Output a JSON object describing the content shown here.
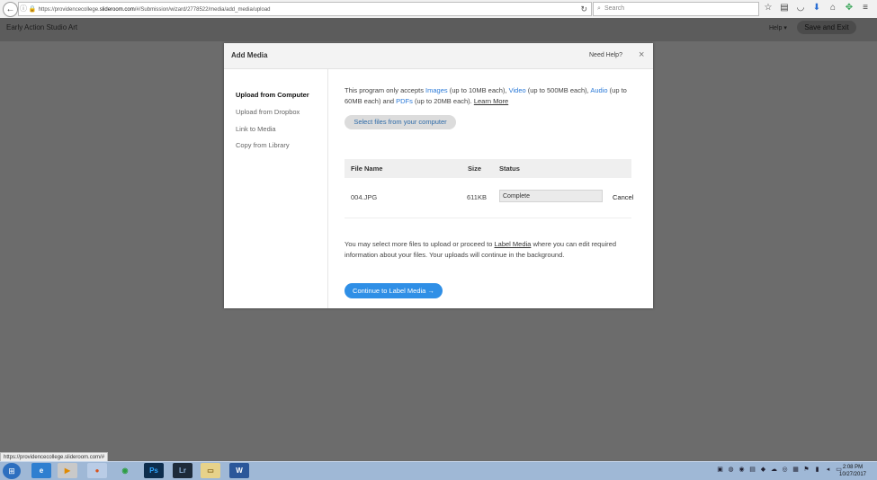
{
  "browser": {
    "url_prefix": "https://providencecollege.",
    "url_domain": "slideroom.com",
    "url_rest": "/#/Submission/wizard/2778522/media/add_media/upload",
    "search_placeholder": "Search"
  },
  "page": {
    "title": "Early Action Studio Art",
    "help_label": "Help",
    "save_exit_label": "Save and Exit"
  },
  "modal": {
    "title": "Add Media",
    "need_help": "Need Help?",
    "close_glyph": "×",
    "nav": [
      {
        "label": "Upload from Computer",
        "active": true
      },
      {
        "label": "Upload from Dropbox"
      },
      {
        "label": "Link to Media"
      },
      {
        "label": "Copy from Library"
      }
    ],
    "desc": {
      "p1": "This program only accepts ",
      "images": "Images",
      "p2": " (up to 10MB each), ",
      "video": "Video",
      "p3": " (up to 500MB each), ",
      "audio": "Audio",
      "p4": " (up to 60MB each) and ",
      "pdfs": "PDFs",
      "p5": " (up to 20MB each). ",
      "learn_more": "Learn More"
    },
    "select_files_label": "Select files from your computer",
    "table": {
      "headers": {
        "file_name": "File Name",
        "size": "Size",
        "status": "Status"
      },
      "rows": [
        {
          "file_name": "004.JPG",
          "size": "611KB",
          "status": "Complete",
          "action": "Cancel"
        }
      ]
    },
    "more": {
      "p1": "You may select more files to upload or proceed to ",
      "label_media": "Label Media",
      "p2": " where you can edit required information about your files. Your uploads will continue in the background."
    },
    "continue_label": "Continue to Label Media →"
  },
  "status_bar_url": "https://providencecollege.slideroom.com/#",
  "taskbar": {
    "time": "2:08 PM",
    "date": "10/27/2017"
  }
}
